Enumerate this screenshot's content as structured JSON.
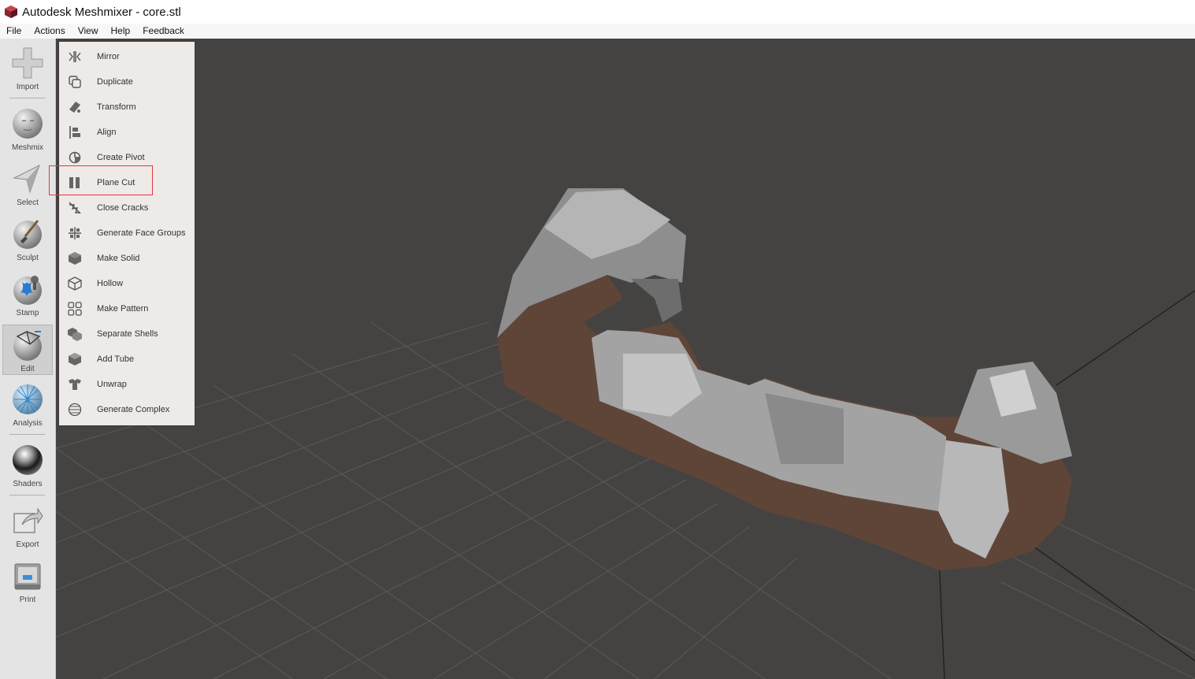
{
  "window": {
    "title": "Autodesk Meshmixer - core.stl"
  },
  "menubar": {
    "items": [
      "File",
      "Actions",
      "View",
      "Help",
      "Feedback"
    ]
  },
  "sidebar": {
    "tools": [
      {
        "label": "Import",
        "icon": "plus-icon"
      },
      {
        "label": "Meshmix",
        "icon": "meshmix-sphere-icon"
      },
      {
        "label": "Select",
        "icon": "select-arrow-icon"
      },
      {
        "label": "Sculpt",
        "icon": "sculpt-brush-icon"
      },
      {
        "label": "Stamp",
        "icon": "stamp-icon"
      },
      {
        "label": "Edit",
        "icon": "edit-icon",
        "active": true
      },
      {
        "label": "Analysis",
        "icon": "analysis-icon"
      },
      {
        "label": "Shaders",
        "icon": "shaders-sphere-icon"
      },
      {
        "label": "Export",
        "icon": "export-icon"
      },
      {
        "label": "Print",
        "icon": "print-icon"
      }
    ]
  },
  "edit_menu": {
    "items": [
      {
        "label": "Mirror",
        "icon": "mirror-icon"
      },
      {
        "label": "Duplicate",
        "icon": "duplicate-icon"
      },
      {
        "label": "Transform",
        "icon": "transform-icon"
      },
      {
        "label": "Align",
        "icon": "align-icon"
      },
      {
        "label": "Create Pivot",
        "icon": "pivot-icon"
      },
      {
        "label": "Plane Cut",
        "icon": "plane-cut-icon",
        "highlighted": true
      },
      {
        "label": "Close Cracks",
        "icon": "close-cracks-icon"
      },
      {
        "label": "Generate Face Groups",
        "icon": "face-groups-icon"
      },
      {
        "label": "Make Solid",
        "icon": "make-solid-icon"
      },
      {
        "label": "Hollow",
        "icon": "hollow-icon"
      },
      {
        "label": "Make Pattern",
        "icon": "pattern-icon"
      },
      {
        "label": "Separate Shells",
        "icon": "separate-shells-icon"
      },
      {
        "label": "Add Tube",
        "icon": "add-tube-icon"
      },
      {
        "label": "Unwrap",
        "icon": "unwrap-icon"
      },
      {
        "label": "Generate Complex",
        "icon": "complex-icon"
      }
    ]
  },
  "colors": {
    "viewport_bg": "#444342",
    "mesh_cut_face": "#5e4538",
    "mesh_surface": "#9a9a9a",
    "highlight": "#e0393e",
    "panel_bg": "#edeae7"
  }
}
